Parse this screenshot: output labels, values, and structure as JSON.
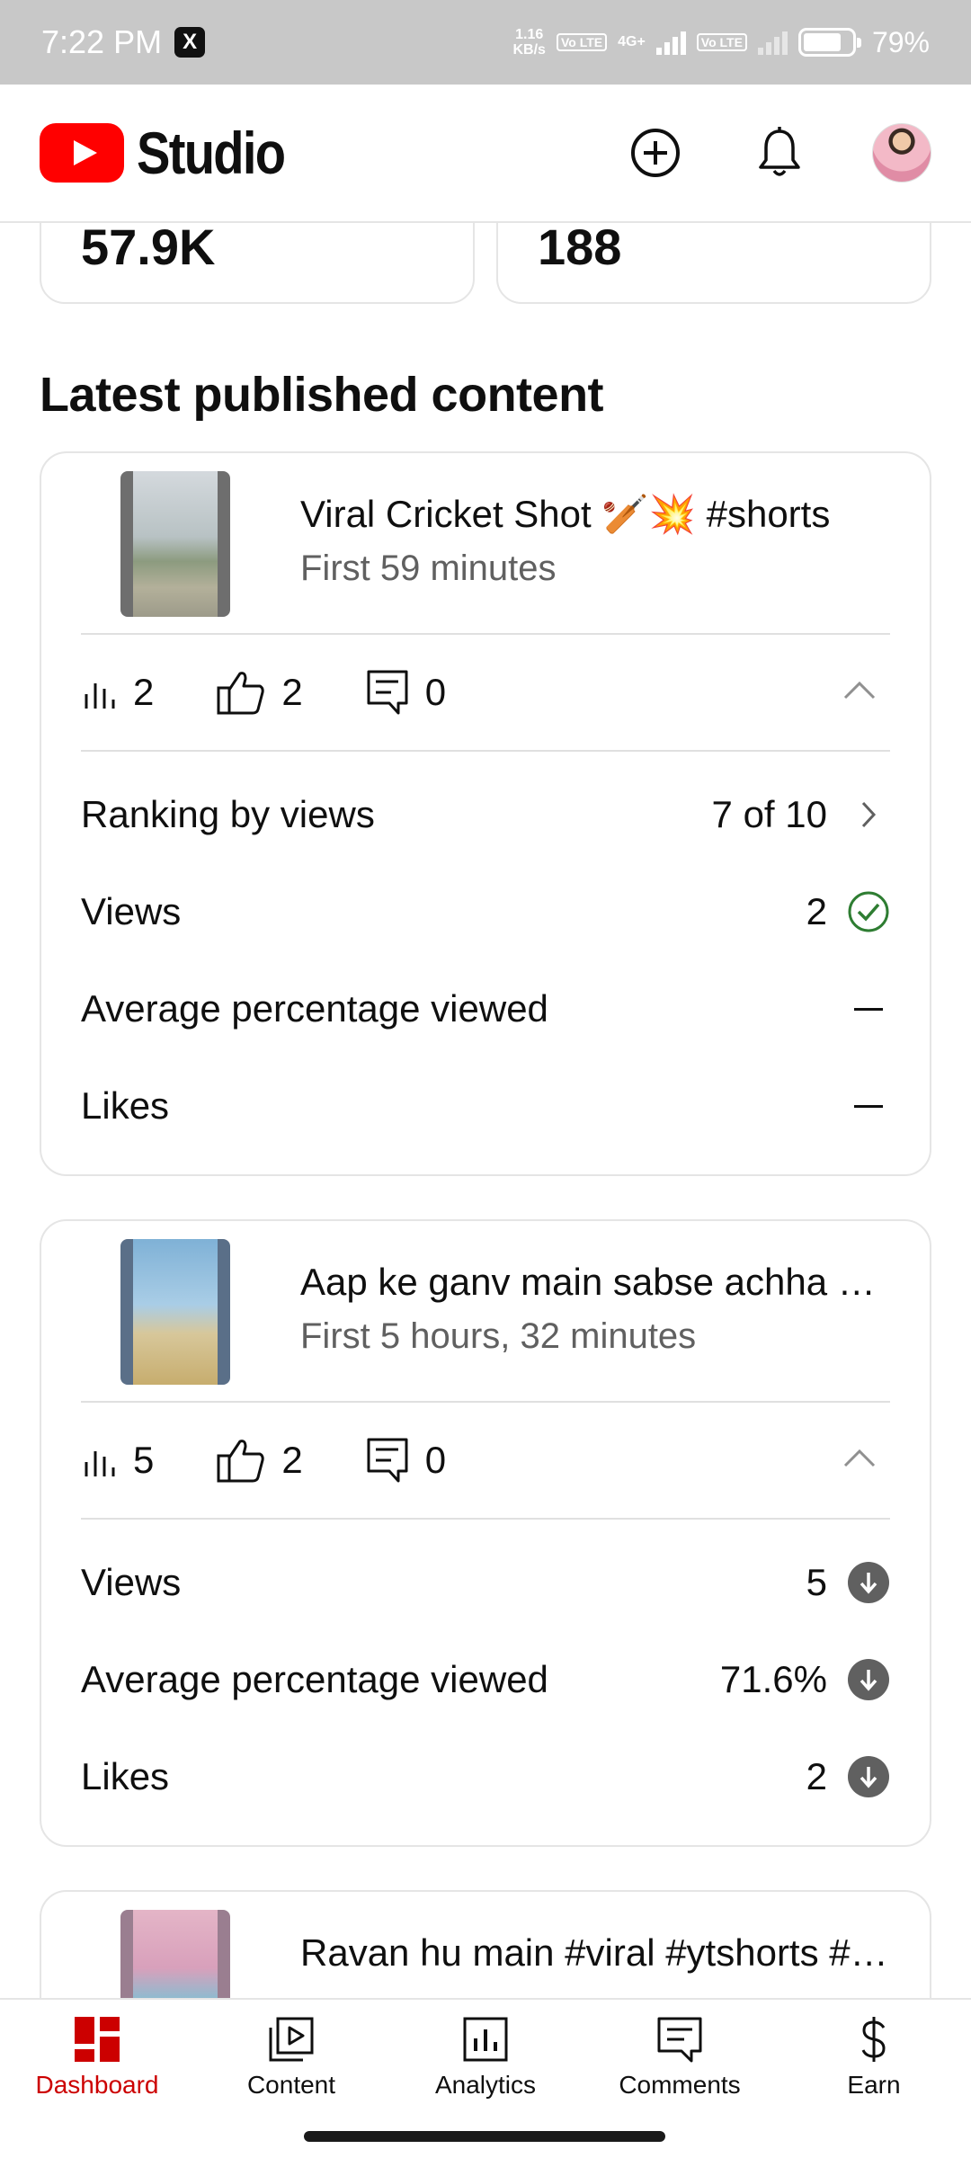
{
  "status_bar": {
    "time": "7:22 PM",
    "x_badge": "X",
    "speed_top": "1.16",
    "speed_bottom": "KB/s",
    "lte1": "Vo LTE",
    "net": "4G+",
    "lte2": "Vo LTE",
    "battery": "79%"
  },
  "header": {
    "app_name": "Studio",
    "icons": [
      "create-icon",
      "notification-bell-icon",
      "account-avatar"
    ]
  },
  "summary_cards": [
    {
      "value": "57.9K"
    },
    {
      "value": "188"
    }
  ],
  "section_title": "Latest published content",
  "videos": [
    {
      "title": "Viral Cricket Shot 🏏💥 #shorts",
      "subtitle": "First 59 minutes",
      "views": "2",
      "likes": "2",
      "comments": "0",
      "rows": [
        {
          "label": "Ranking by views",
          "value": "7 of 10",
          "icon": "chevron-right-icon"
        },
        {
          "label": "Views",
          "value": "2",
          "icon": "check-circle-icon"
        },
        {
          "label": "Average percentage viewed",
          "value": "",
          "icon": "dash-icon"
        },
        {
          "label": "Likes",
          "value": "",
          "icon": "dash-icon"
        }
      ]
    },
    {
      "title": "Aap ke ganv main sabse achha khiladi kaun hai",
      "subtitle": "First 5 hours, 32 minutes",
      "views": "5",
      "likes": "2",
      "comments": "0",
      "rows": [
        {
          "label": "Views",
          "value": "5",
          "icon": "arrow-down-circle-icon"
        },
        {
          "label": "Average percentage viewed",
          "value": "71.6%",
          "icon": "arrow-down-circle-icon"
        },
        {
          "label": "Likes",
          "value": "2",
          "icon": "arrow-down-circle-icon"
        }
      ]
    },
    {
      "title": "Ravan hu main #viral #ytshorts #shorts",
      "subtitle": ""
    }
  ],
  "bottom_nav": [
    {
      "label": "Dashboard",
      "active": true
    },
    {
      "label": "Content"
    },
    {
      "label": "Analytics"
    },
    {
      "label": "Comments"
    },
    {
      "label": "Earn"
    }
  ],
  "colors": {
    "accent_red": "#cc0000",
    "youtube_red": "#ff0000",
    "check_green": "#2e7d32",
    "secondary_text": "#606060"
  }
}
